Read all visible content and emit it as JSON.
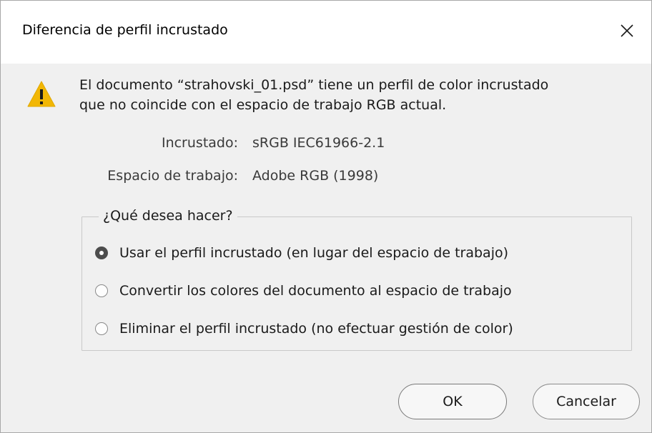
{
  "window": {
    "title": "Diferencia de perfil incrustado",
    "close_icon": "close-icon"
  },
  "message": {
    "icon": "warning-icon",
    "line1": "El documento “strahovski_01.psd” tiene un perfil de color incrustado",
    "line2": "que no coincide con el espacio de trabajo RGB actual."
  },
  "profiles": {
    "embedded_label": "Incrustado:",
    "embedded_value": "sRGB IEC61966-2.1",
    "workspace_label": "Espacio de trabajo:",
    "workspace_value": "Adobe RGB (1998)"
  },
  "options": {
    "legend": "¿Qué desea hacer?",
    "items": [
      {
        "label": "Usar el perfil incrustado (en lugar del espacio de trabajo)",
        "checked": true
      },
      {
        "label": "Convertir los colores del documento al espacio de trabajo",
        "checked": false
      },
      {
        "label": "Eliminar el perfil incrustado (no efectuar gestión de color)",
        "checked": false
      }
    ]
  },
  "buttons": {
    "ok_label": "OK",
    "cancel_label": "Cancelar"
  },
  "colors": {
    "warning": "#f2b705",
    "background": "#f0f0f0",
    "titlebar": "#ffffff"
  }
}
